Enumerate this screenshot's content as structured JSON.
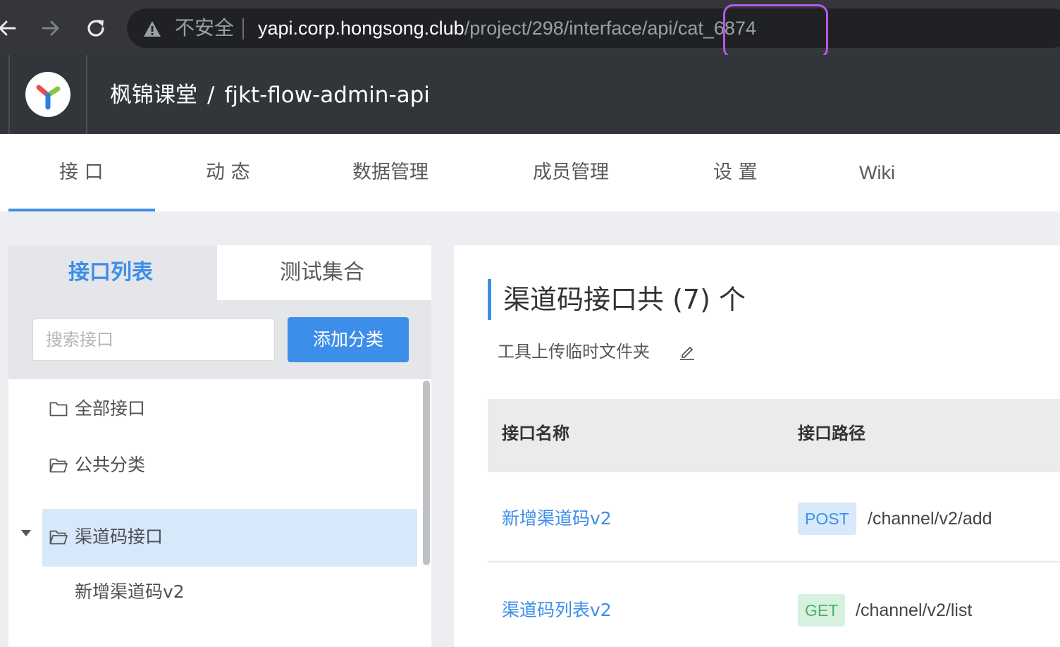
{
  "browser": {
    "insecure_label": "不安全",
    "url_host": "yapi.corp.hongsong.club",
    "url_path": "/project/298/interface/api/cat_6874"
  },
  "header": {
    "group": "枫锦课堂",
    "separator": "/",
    "project": "fjkt-flow-admin-api"
  },
  "tabs": [
    {
      "label": "接 口"
    },
    {
      "label": "动 态"
    },
    {
      "label": "数据管理"
    },
    {
      "label": "成员管理"
    },
    {
      "label": "设 置"
    },
    {
      "label": "Wiki"
    }
  ],
  "left_panel": {
    "tab_interfaces": "接口列表",
    "tab_test": "测试集合",
    "search_placeholder": "搜索接口",
    "add_category": "添加分类",
    "tree": [
      {
        "label": "全部接口"
      },
      {
        "label": "公共分类"
      },
      {
        "label": "渠道码接口"
      }
    ],
    "child": "新增渠道码v2"
  },
  "right_panel": {
    "title": "渠道码接口共 (7) 个",
    "description": "工具上传临时文件夹",
    "col_name": "接口名称",
    "col_path": "接口路径",
    "rows": [
      {
        "name": "新增渠道码v2",
        "method": "POST",
        "path": "/channel/v2/add"
      },
      {
        "name": "渠道码列表v2",
        "method": "GET",
        "path": "/channel/v2/list"
      }
    ]
  }
}
